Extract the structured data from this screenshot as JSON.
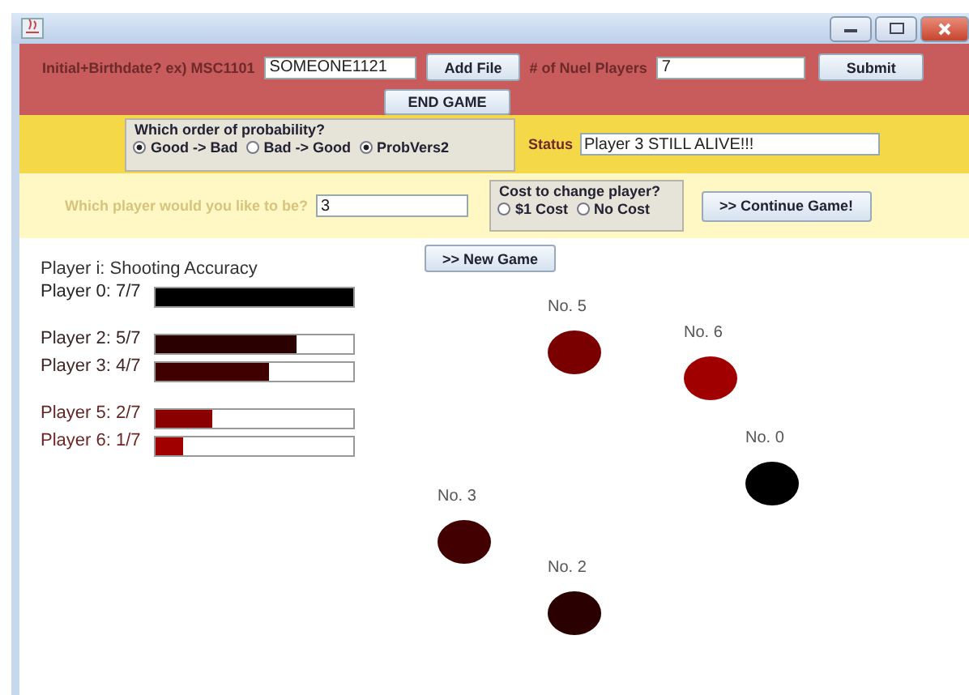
{
  "top_bar": {
    "id_label": "Initial+Birthdate? ex) MSC1101",
    "id_value": "SOMEONE1121",
    "add_file": "Add File",
    "players_label": "# of Nuel Players",
    "players_value": "7",
    "submit": "Submit",
    "end_game": "END GAME"
  },
  "probability": {
    "legend": "Which order of probability?",
    "options": [
      {
        "label": "Good -> Bad",
        "selected": true
      },
      {
        "label": "Bad -> Good",
        "selected": false
      },
      {
        "label": "ProbVers2",
        "selected": true
      }
    ],
    "status_label": "Status",
    "status_value": "Player 3 STILL ALIVE!!!"
  },
  "choose": {
    "label": "Which player would you like to be?",
    "value": "3",
    "cost_legend": "Cost to change player?",
    "cost_options": [
      {
        "label": "$1 Cost",
        "selected": false
      },
      {
        "label": "No Cost",
        "selected": false
      }
    ],
    "continue": ">> Continue Game!"
  },
  "new_game": ">> New Game",
  "accuracy_title": "Player i: Shooting Accuracy",
  "accuracy_groups": [
    [
      {
        "label": "Player 0: 7/7",
        "level": 1.0,
        "color": "#000000"
      }
    ],
    [
      {
        "label": "Player 2: 5/7",
        "level": 0.714,
        "color": "#2b0000"
      },
      {
        "label": "Player 3: 4/7",
        "level": 0.571,
        "color": "#400000"
      }
    ],
    [
      {
        "label": "Player 5: 2/7",
        "level": 0.286,
        "color": "#8a0000"
      },
      {
        "label": "Player 6: 1/7",
        "level": 0.143,
        "color": "#a00000"
      }
    ]
  ],
  "players": [
    {
      "label": "No. 5",
      "color": "#7a0000"
    },
    {
      "label": "No. 6",
      "color": "#a00000"
    },
    {
      "label": "No. 0",
      "color": "#000000"
    },
    {
      "label": "No. 3",
      "color": "#420000"
    },
    {
      "label": "No. 2",
      "color": "#2b0000"
    }
  ]
}
